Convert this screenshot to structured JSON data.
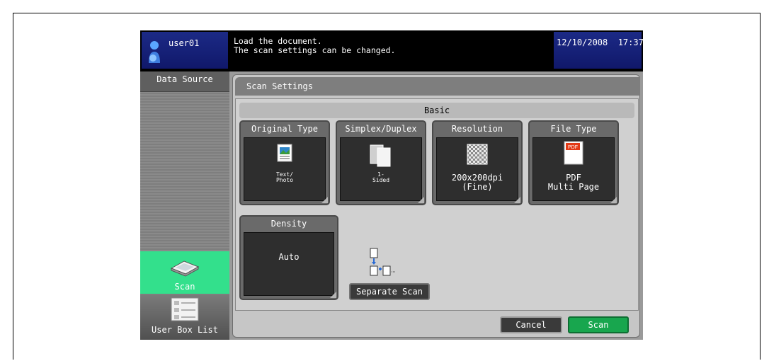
{
  "header": {
    "user_name": "user01",
    "message_line1": "Load the document.",
    "message_line2": "The scan settings can be changed.",
    "datetime": "12/10/2008  17:37"
  },
  "sidebar": {
    "title": "Data Source",
    "items": [
      {
        "label": "Scan",
        "icon": "scanner-icon",
        "active": true
      },
      {
        "label": "User Box List",
        "icon": "user-box-list-icon",
        "active": false
      }
    ]
  },
  "main": {
    "title": "Scan Settings",
    "section": "Basic",
    "tiles": [
      {
        "title": "Original Type",
        "value_line1": "Text/",
        "value_line2": "Photo",
        "icon": "text-photo-icon"
      },
      {
        "title": "Simplex/Duplex",
        "value_line1": "1-",
        "value_line2": "Sided",
        "icon": "simplex-pages-icon"
      },
      {
        "title": "Resolution",
        "value_line1": "200x200dpi",
        "value_line2": "(Fine)",
        "icon": "resolution-checker-icon"
      },
      {
        "title": "File Type",
        "value_line1": "PDF",
        "value_line2": "Multi Page",
        "icon": "pdf-file-icon",
        "icon_text": "PDF"
      },
      {
        "title": "Density",
        "value_line1": "Auto",
        "value_line2": ""
      }
    ],
    "separate_scan_label": "Separate Scan"
  },
  "footer": {
    "cancel_label": "Cancel",
    "scan_label": "Scan"
  },
  "colors": {
    "header_blue": "#1c2a86",
    "scan_green": "#33e08c",
    "scan_button_green": "#18a64e"
  }
}
